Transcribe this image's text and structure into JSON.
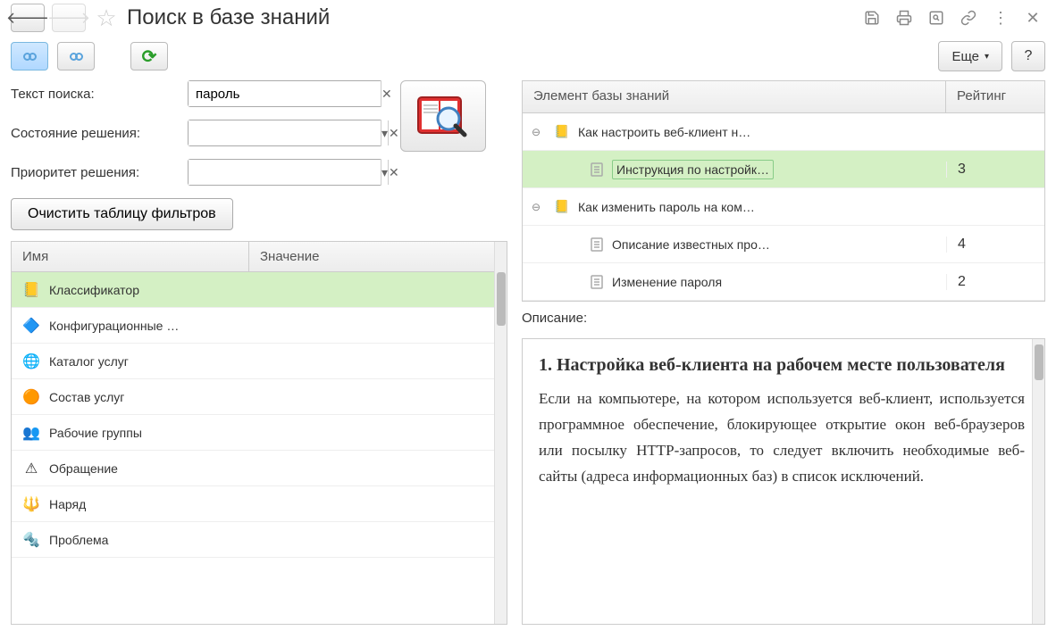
{
  "header": {
    "title": "Поиск в базе знаний"
  },
  "toolbar": {
    "more_label": "Еще",
    "help_label": "?"
  },
  "filters": {
    "search_label": "Текст поиска:",
    "search_value": "пароль",
    "status_label": "Состояние решения:",
    "status_value": "",
    "priority_label": "Приоритет решения:",
    "priority_value": "",
    "clear_label": "Очистить таблицу фильтров"
  },
  "filter_table": {
    "col_name": "Имя",
    "col_value": "Значение",
    "rows": [
      {
        "label": "Классификатор",
        "icon": "📒",
        "selected": true
      },
      {
        "label": "Конфигурационные …",
        "icon": "🔷",
        "selected": false
      },
      {
        "label": "Каталог услуг",
        "icon": "🌐",
        "selected": false
      },
      {
        "label": "Состав услуг",
        "icon": "🟠",
        "selected": false
      },
      {
        "label": "Рабочие группы",
        "icon": "👥",
        "selected": false
      },
      {
        "label": "Обращение",
        "icon": "⚠",
        "selected": false
      },
      {
        "label": "Наряд",
        "icon": "🔱",
        "selected": false
      },
      {
        "label": "Проблема",
        "icon": "🔩",
        "selected": false
      }
    ]
  },
  "kb": {
    "col_element": "Элемент базы знаний",
    "col_rating": "Рейтинг",
    "rows": [
      {
        "type": "folder",
        "label": "Как настроить веб-клиент н…",
        "rating": "",
        "indent": 0,
        "expanded": true
      },
      {
        "type": "doc",
        "label": "Инструкция по настройк…",
        "rating": "3",
        "indent": 1,
        "selected": true
      },
      {
        "type": "folder",
        "label": "Как изменить пароль на ком…",
        "rating": "",
        "indent": 0,
        "expanded": true
      },
      {
        "type": "doc",
        "label": "Описание известных про…",
        "rating": "4",
        "indent": 1
      },
      {
        "type": "doc",
        "label": "Изменение пароля",
        "rating": "2",
        "indent": 1
      }
    ]
  },
  "description": {
    "label": "Описание:",
    "heading": "1. Настройка веб-клиента на рабочем месте пользователя",
    "body": "Если на компьютере, на котором используется веб-клиент, используется программное обеспечение, блокирующее открытие окон веб-браузеров или посылку HTTP-запросов, то следует включить необходимые веб-сайты (адреса информационных баз) в список исключений."
  }
}
